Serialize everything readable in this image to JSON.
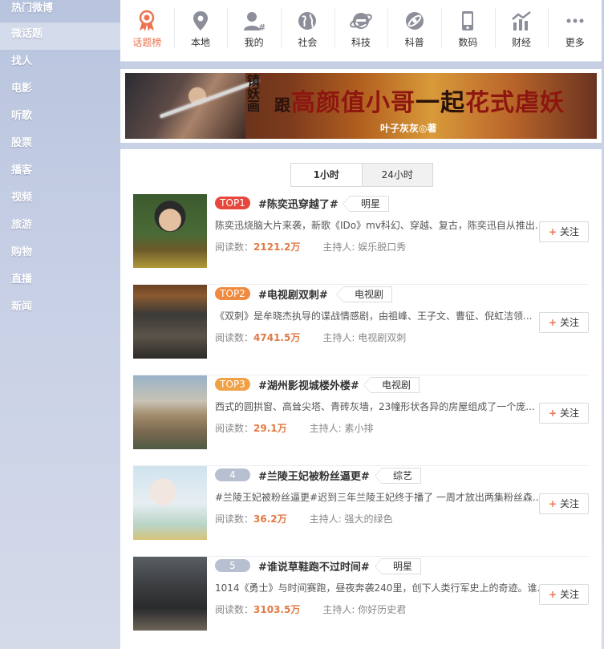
{
  "sidebar": {
    "items": [
      "热门微博",
      "微话题",
      "找人",
      "电影",
      "听歌",
      "股票",
      "播客",
      "视频",
      "旅游",
      "购物",
      "直播",
      "新闻"
    ]
  },
  "categories": [
    {
      "label": "话题榜",
      "icon": "medal-icon"
    },
    {
      "label": "本地",
      "icon": "location-pin-icon"
    },
    {
      "label": "我的",
      "icon": "user-hash-icon"
    },
    {
      "label": "社会",
      "icon": "globe-icon"
    },
    {
      "label": "科技",
      "icon": "browser-e-icon"
    },
    {
      "label": "科普",
      "icon": "science-icon"
    },
    {
      "label": "数码",
      "icon": "phone-icon"
    },
    {
      "label": "财经",
      "icon": "trend-chart-icon"
    },
    {
      "label": "更多",
      "icon": "more-dots-icon"
    }
  ],
  "banner": {
    "left_text": "镇妖画",
    "text_a": "跟",
    "text_b": "高颜值小哥",
    "text_c": "一起",
    "text_d": "花式虐妖",
    "author": "叶子灰灰◎著"
  },
  "tabs": [
    "1小时",
    "24小时"
  ],
  "labels": {
    "reads": "阅读数：",
    "host": "主持人:",
    "follow": "关注"
  },
  "topics": [
    {
      "rank": "TOP1",
      "title": "#陈奕迅穿越了#",
      "tag": "明星",
      "desc": "陈奕迅烧脑大片来袭，新歌《IDo》mv科幻、穿越、复古，陈奕迅自从推出...",
      "reads": "2121.2万",
      "host": "娱乐脱口秀"
    },
    {
      "rank": "TOP2",
      "title": "#电视剧双刺#",
      "tag": "电视剧",
      "desc": "《双刺》是牟晓杰执导的谍战情感剧，由祖峰、王子文、曹征、倪虹洁领...",
      "reads": "4741.5万",
      "host": "电视剧双刺"
    },
    {
      "rank": "TOP3",
      "title": "#湖州影视城楼外楼#",
      "tag": "电视剧",
      "desc": "西式的圆拱窗、高耸尖塔、青砖灰墙，23幢形状各异的房屋组成了一个庞...",
      "reads": "29.1万",
      "host": "素小排"
    },
    {
      "rank": "4",
      "title": "#兰陵王妃被粉丝逼更#",
      "tag": "综艺",
      "desc": "#兰陵王妃被粉丝逼更#迟到三年兰陵王妃终于播了 一周才放出两集粉丝森...",
      "reads": "36.2万",
      "host": "强大的绿色"
    },
    {
      "rank": "5",
      "title": "#谁说草鞋跑不过时间#",
      "tag": "明星",
      "desc": "1014《勇士》与时间赛跑，昼夜奔袭240里，创下人类行军史上的奇迹。谁...",
      "reads": "3103.5万",
      "host": "你好历史君"
    }
  ],
  "colors": {
    "accent": "#eb7350",
    "top1": "#e8473d",
    "top2": "#ef8a3e",
    "top3": "#f0a045",
    "rank_gray": "#b7bfd0"
  }
}
